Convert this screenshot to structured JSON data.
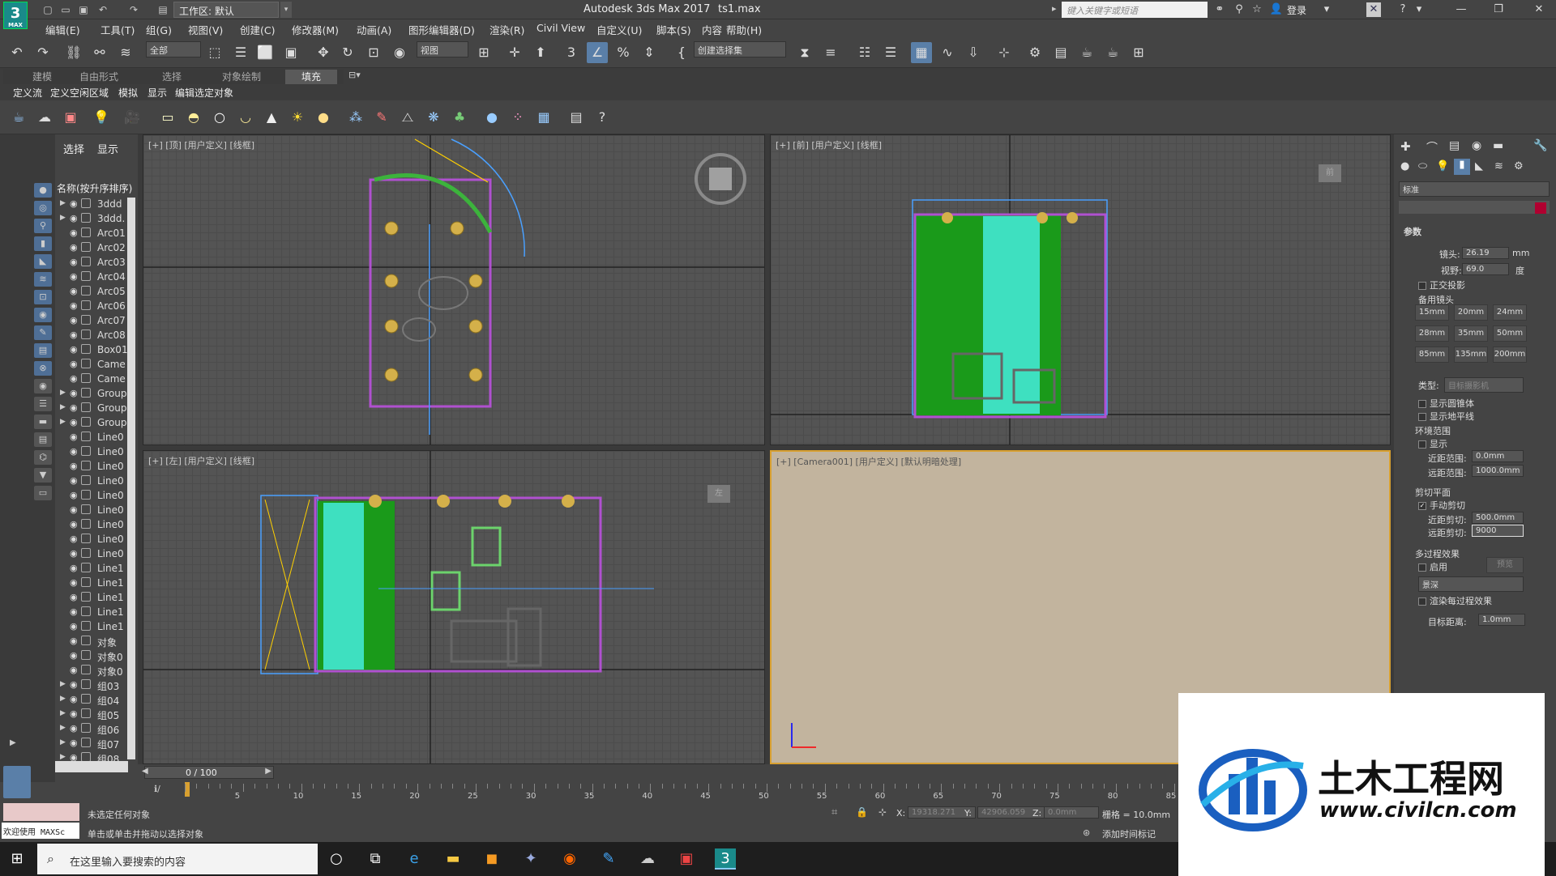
{
  "titlebar": {
    "logo": "3",
    "logo_sub": "MAX",
    "workspace_label": "工作区: 默认",
    "app_title": "Autodesk 3ds Max 2017",
    "file_name": "ts1.max",
    "search_placeholder": "键入关键字或短语",
    "login": "登录"
  },
  "menu": [
    "编辑(E)",
    "工具(T)",
    "组(G)",
    "视图(V)",
    "创建(C)",
    "修改器(M)",
    "动画(A)",
    "图形编辑器(D)",
    "渲染(R)",
    "Civil View",
    "自定义(U)",
    "脚本(S)",
    "内容",
    "帮助(H)"
  ],
  "toolbar": {
    "selection_filter": "全部",
    "ref_coord": "视图",
    "named_selection": "创建选择集"
  },
  "ribbon": {
    "tabs": [
      "建模",
      "自由形式",
      "选择",
      "对象绘制",
      "填充"
    ],
    "active_tab": "填充",
    "subtabs": [
      "定义流",
      "定义空闲区域",
      "模拟",
      "显示",
      "编辑选定对象"
    ]
  },
  "scene_explorer": {
    "tabs": [
      "选择",
      "显示"
    ],
    "header": "名称(按升序排序)",
    "rows": [
      "3ddd",
      "3ddd.",
      "Arc01",
      "Arc02",
      "Arc03",
      "Arc04",
      "Arc05",
      "Arc06",
      "Arc07",
      "Arc08",
      "Box01",
      "Came",
      "Came",
      "Group",
      "Group",
      "Group",
      "Line0",
      "Line0",
      "Line0",
      "Line0",
      "Line0",
      "Line0",
      "Line0",
      "Line0",
      "Line0",
      "Line1",
      "Line1",
      "Line1",
      "Line1",
      "Line1",
      "对象",
      "对象0",
      "对象0",
      "组03",
      "组04",
      "组05",
      "组06",
      "组07",
      "组08"
    ]
  },
  "viewports": {
    "top_label": "[+] [顶] [用户定义] [线框]",
    "front_label": "[+] [前] [用户定义] [线框]",
    "left_label": "[+] [左] [用户定义] [线框]",
    "camera_label": "[+] [Camera001] [用户定义] [默认明暗处理]",
    "camera_bg": "#c2b49e",
    "viewcube_front": "前",
    "viewcube_left": "左"
  },
  "command_panel": {
    "dropdown": "标准",
    "rollout": "参数",
    "lens_label": "镜头:",
    "lens_value": "26.19",
    "lens_unit": "mm",
    "fov_label": "视野:",
    "fov_value": "69.0",
    "fov_unit": "度",
    "ortho": "正交投影",
    "stock_lens": "备用镜头",
    "lens_buttons": [
      "15mm",
      "20mm",
      "24mm",
      "28mm",
      "35mm",
      "50mm",
      "85mm",
      "135mm",
      "200mm"
    ],
    "type_label": "类型:",
    "type_value": "目标摄影机",
    "show_cone": "显示圆锥体",
    "show_horizon": "显示地平线",
    "env_range": "环境范围",
    "show": "显示",
    "near_range_label": "近距范围:",
    "near_range": "0.0mm",
    "far_range_label": "远距范围:",
    "far_range": "1000.0mm",
    "clip_plane": "剪切平面",
    "manual_clip": "手动剪切",
    "near_clip_label": "近距剪切:",
    "near_clip": "500.0mm",
    "far_clip_label": "远距剪切:",
    "far_clip": "9000",
    "multi_pass": "多过程效果",
    "enable": "启用",
    "preview": "预览",
    "effect": "景深",
    "render_each": "渲染每过程效果",
    "target_dist_label": "目标距离:",
    "target_dist": "1.0mm"
  },
  "timeline": {
    "frame": "0 / 100",
    "ticks": [
      "5",
      "10",
      "15",
      "20",
      "25",
      "30",
      "35",
      "40",
      "45",
      "50",
      "55",
      "60",
      "65",
      "70",
      "75",
      "80",
      "85"
    ]
  },
  "status": {
    "maxscript": "欢迎使用 MAXSc",
    "line1": "未选定任何对象",
    "line2": "单击或单击并拖动以选择对象",
    "x_label": "X:",
    "x_value": "19318.271",
    "y_label": "Y:",
    "y_value": "42906.059",
    "z_label": "Z:",
    "z_value": "0.0mm",
    "grid": "栅格 = 10.0mm",
    "add_time_tag": "添加时间标记"
  },
  "taskbar": {
    "search_placeholder": "在这里输入要搜索的内容"
  },
  "watermark": {
    "title": "土木工程网",
    "url": "www.civilcn.com"
  }
}
